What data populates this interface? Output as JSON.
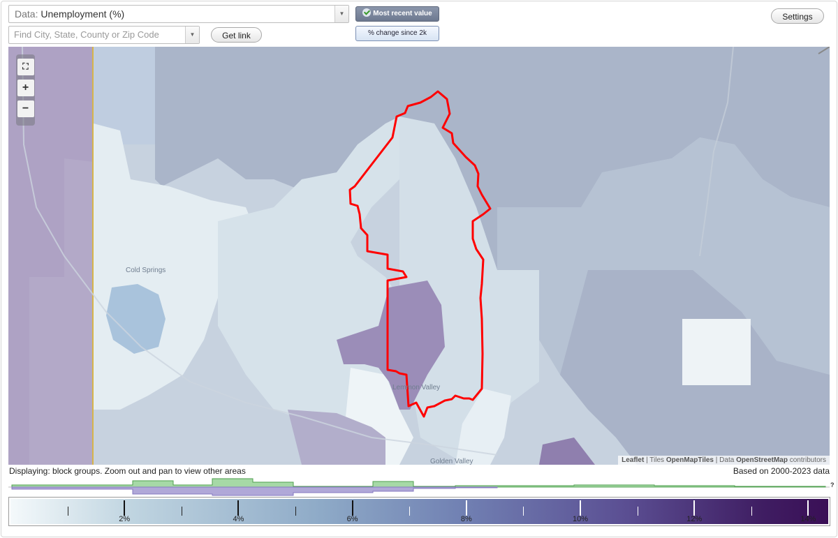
{
  "controls": {
    "data_prefix": "Data:",
    "data_value": "Unemployment (%)",
    "search_placeholder": "Find City, State, County or Zip Code",
    "get_link": "Get link",
    "most_recent": "Most recent value",
    "pct_change": "% change since 2k",
    "settings": "Settings"
  },
  "map": {
    "zoom_in": "+",
    "zoom_out": "−",
    "places": [
      "Cold Springs",
      "Lemmon Valley",
      "Golden Valley"
    ],
    "attribution": {
      "leaflet": "Leaflet",
      "sep1": " | Tiles ",
      "tiles": "OpenMapTiles",
      "sep2": " | Data ",
      "data": "OpenStreetMap",
      "contrib": " contributors"
    }
  },
  "footer": {
    "displaying": "Displaying: block groups. Zoom out and pan to view other areas",
    "based_on": "Based on 2000-2023 data",
    "help": "?"
  },
  "legend": {
    "min_pct": 0,
    "max_pct": 14.35,
    "major_ticks": [
      {
        "value": 2,
        "label": "2%"
      },
      {
        "value": 4,
        "label": "4%"
      },
      {
        "value": 6,
        "label": "6%"
      },
      {
        "value": 8,
        "label": "8%"
      },
      {
        "value": 10,
        "label": "10%"
      },
      {
        "value": 12,
        "label": "12%"
      },
      {
        "value": 14,
        "label": "14%"
      }
    ],
    "minor_ticks": [
      1,
      3,
      5,
      7,
      9,
      11,
      13
    ]
  },
  "colors": {
    "highlight_border": "#ff0000",
    "histogram_green": "#8fcf8f",
    "histogram_purple": "#9a9ad0"
  }
}
